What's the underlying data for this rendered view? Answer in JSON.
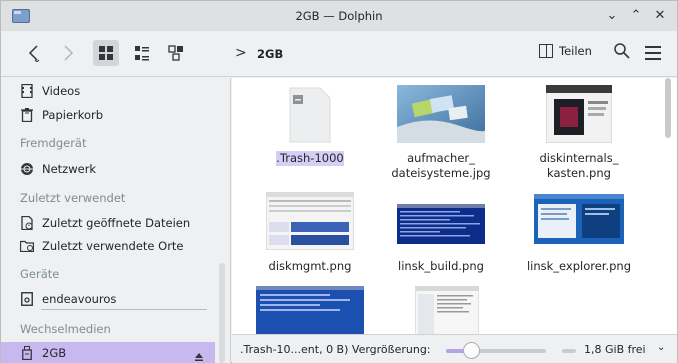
{
  "window": {
    "title": "2GB — Dolphin",
    "controls": {
      "minimize": "⌄",
      "maximize": "⌃",
      "close": "✕"
    }
  },
  "toolbar": {
    "back_icon": "chevron-left-icon",
    "forward_icon": "chevron-right-icon",
    "view_modes": [
      "icons-view-icon",
      "compact-view-icon",
      "details-view-icon"
    ],
    "breadcrumb_separator": ">",
    "breadcrumb": "2GB",
    "split_label": "Teilen",
    "search_icon": "search-icon",
    "menu_icon": "hamburger-menu-icon"
  },
  "sidebar": {
    "items_top": [
      {
        "label": "Videos",
        "icon": "video-icon"
      },
      {
        "label": "Papierkorb",
        "icon": "trash-icon"
      }
    ],
    "section_remote": "Fremdgerät",
    "remote_items": [
      {
        "label": "Netzwerk",
        "icon": "network-icon"
      }
    ],
    "section_recent": "Zuletzt verwendet",
    "recent_items": [
      {
        "label": "Zuletzt geöffnete Dateien",
        "icon": "recent-files-icon"
      },
      {
        "label": "Zuletzt verwendete Orte",
        "icon": "recent-places-icon"
      }
    ],
    "section_devices": "Geräte",
    "device_items": [
      {
        "label": "endeavouros",
        "icon": "drive-icon"
      }
    ],
    "section_removable": "Wechselmedien",
    "removable_items": [
      {
        "label": "2GB",
        "icon": "usb-drive-icon",
        "selected": true
      }
    ],
    "eject_icon": "eject-icon"
  },
  "files": [
    {
      "name": ".Trash-1000",
      "type": "folder",
      "selected": true
    },
    {
      "name": "aufmacher_\ndateisysteme.jpg",
      "line1": "aufmacher_",
      "line2": "dateisysteme.jpg",
      "type": "image"
    },
    {
      "name": "diskinternals_\nkasten.png",
      "line1": "diskinternals_",
      "line2": "kasten.png",
      "type": "image"
    },
    {
      "name": "diskmgmt.png",
      "type": "image"
    },
    {
      "name": "linsk_build.png",
      "type": "image"
    },
    {
      "name": "linsk_explorer.png",
      "type": "image"
    },
    {
      "name": "",
      "type": "image"
    },
    {
      "name": "",
      "type": "image"
    }
  ],
  "status": {
    "text": ".Trash-10...ent, 0 B)",
    "zoom_label": "Vergrößerung:",
    "zoom_level": 0.25,
    "free_space": "1,8 GiB frei"
  },
  "colors": {
    "accent": "#c7b8f0",
    "window_bg": "#eff0f1",
    "content_bg": "#ffffff"
  }
}
